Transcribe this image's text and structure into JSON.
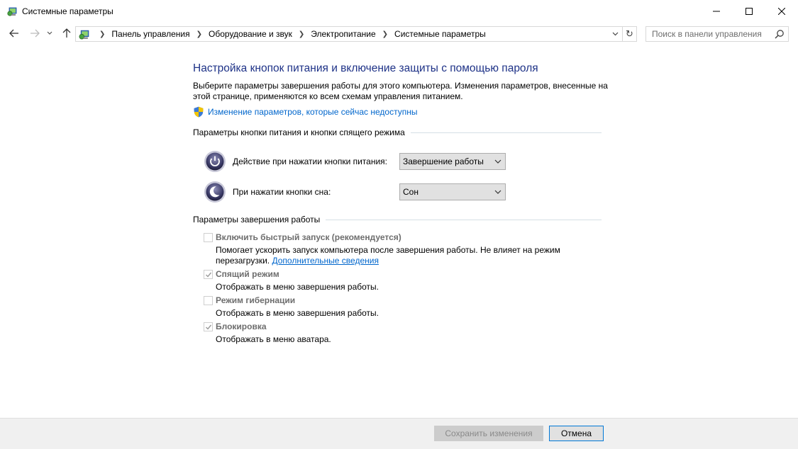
{
  "window": {
    "title": "Системные параметры"
  },
  "address": {
    "crumbs": [
      "Панель управления",
      "Оборудование и звук",
      "Электропитание",
      "Системные параметры"
    ],
    "search_placeholder": "Поиск в панели управления"
  },
  "main": {
    "title": "Настройка кнопок питания и включение защиты с помощью пароля",
    "description": "Выберите параметры завершения работы для этого компьютера. Изменения параметров, внесенные на этой странице, применяются ко всем схемам управления питанием.",
    "change_link": "Изменение параметров, которые сейчас недоступны",
    "section_power": "Параметры кнопки питания и кнопки спящего режима",
    "power_button_label": "Действие при нажатии кнопки питания:",
    "power_button_value": "Завершение работы",
    "sleep_button_label": "При нажатии кнопки сна:",
    "sleep_button_value": "Сон",
    "section_shutdown": "Параметры завершения работы",
    "options": [
      {
        "title": "Включить быстрый запуск (рекомендуется)",
        "desc": "Помогает ускорить запуск компьютера после завершения работы. Не влияет на режим перезагрузки.",
        "link": "Дополнительные сведения",
        "checked": false
      },
      {
        "title": "Спящий режим",
        "desc": "Отображать в меню завершения работы.",
        "checked": true
      },
      {
        "title": "Режим гибернации",
        "desc": "Отображать в меню завершения работы.",
        "checked": false
      },
      {
        "title": "Блокировка",
        "desc": "Отображать в меню аватара.",
        "checked": true
      }
    ]
  },
  "footer": {
    "save_label": "Сохранить изменения",
    "cancel_label": "Отмена"
  },
  "colors": {
    "title_blue": "#1e3287",
    "link_blue": "#0066cc",
    "disabled_gray": "#6d6d6d"
  }
}
